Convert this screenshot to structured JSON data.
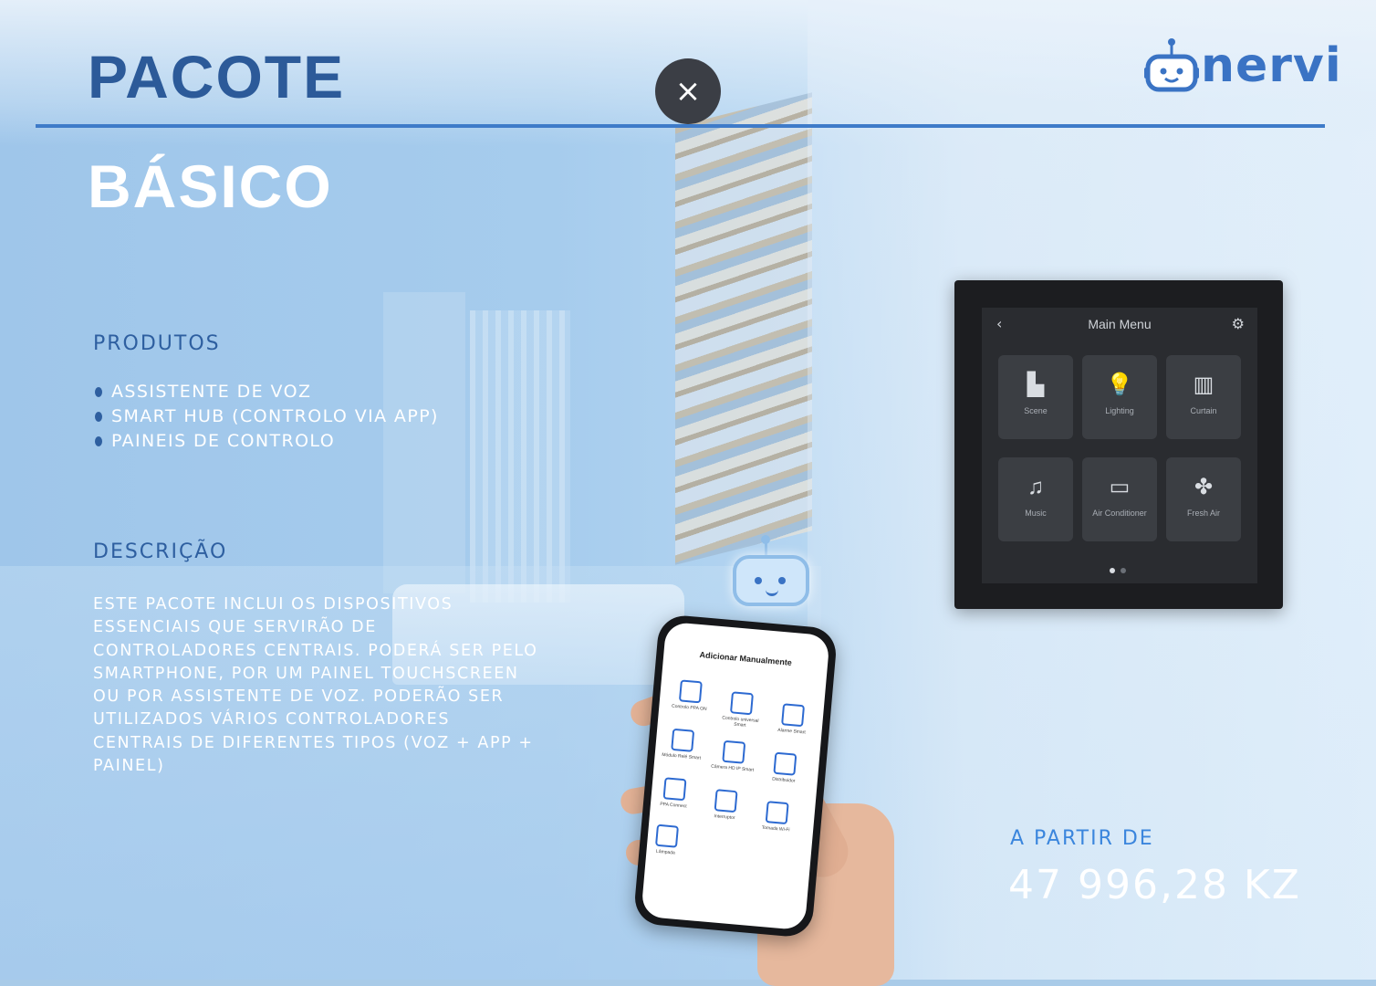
{
  "header": {
    "title_line1": "PACOTE",
    "title_line2": "BÁSICO",
    "close_glyph": "×",
    "logo_text": "nervi"
  },
  "products": {
    "heading": "PRODUTOS",
    "items": [
      "ASSISTENTE DE VOZ",
      "SMART HUB (CONTROLO VIA APP)",
      "PAINEIS DE CONTROLO"
    ]
  },
  "description": {
    "heading": "DESCRIÇÃO",
    "text": "ESTE PACOTE INCLUI OS DISPOSITIVOS ESSENCIAIS QUE SERVIRÃO DE CONTROLADORES CENTRAIS. PODERÁ SER PELO SMARTPHONE, POR UM PAINEL TOUCHSCREEN OU POR ASSISTENTE DE VOZ. PODERÃO SER UTILIZADOS VÁRIOS CONTROLADORES CENTRAIS DE DIFERENTES TIPOS (VOZ + APP + PAINEL)"
  },
  "price": {
    "label": "A PARTIR DE",
    "value": "47 996,28 KZ"
  },
  "control_panel": {
    "title": "Main Menu",
    "tiles": [
      {
        "icon": "scene-icon",
        "glyph": "▙",
        "label": "Scene"
      },
      {
        "icon": "lighting-icon",
        "glyph": "💡",
        "label": "Lighting"
      },
      {
        "icon": "curtain-icon",
        "glyph": "▥",
        "label": "Curtain"
      },
      {
        "icon": "music-icon",
        "glyph": "♫",
        "label": "Music"
      },
      {
        "icon": "air-conditioner-icon",
        "glyph": "▭",
        "label": "Air Conditioner"
      },
      {
        "icon": "fresh-air-icon",
        "glyph": "✤",
        "label": "Fresh Air"
      }
    ]
  },
  "phone_app": {
    "title": "Adicionar Manualmente",
    "apps": [
      "Controlo PPA ON",
      "Controlo universal Smart",
      "Alarme Smart",
      "Módulo Relé Smart",
      "Câmera HD IP Smart",
      "Distribuidor",
      "PPA Connect",
      "Interruptor",
      "Tomada Wi-Fi",
      "Lâmpada"
    ]
  },
  "colors": {
    "title_blue": "#2c5a99",
    "rule_blue": "#3e7bc9",
    "price_label_blue": "#3b86dd",
    "close_button_bg": "#3b3e45"
  }
}
